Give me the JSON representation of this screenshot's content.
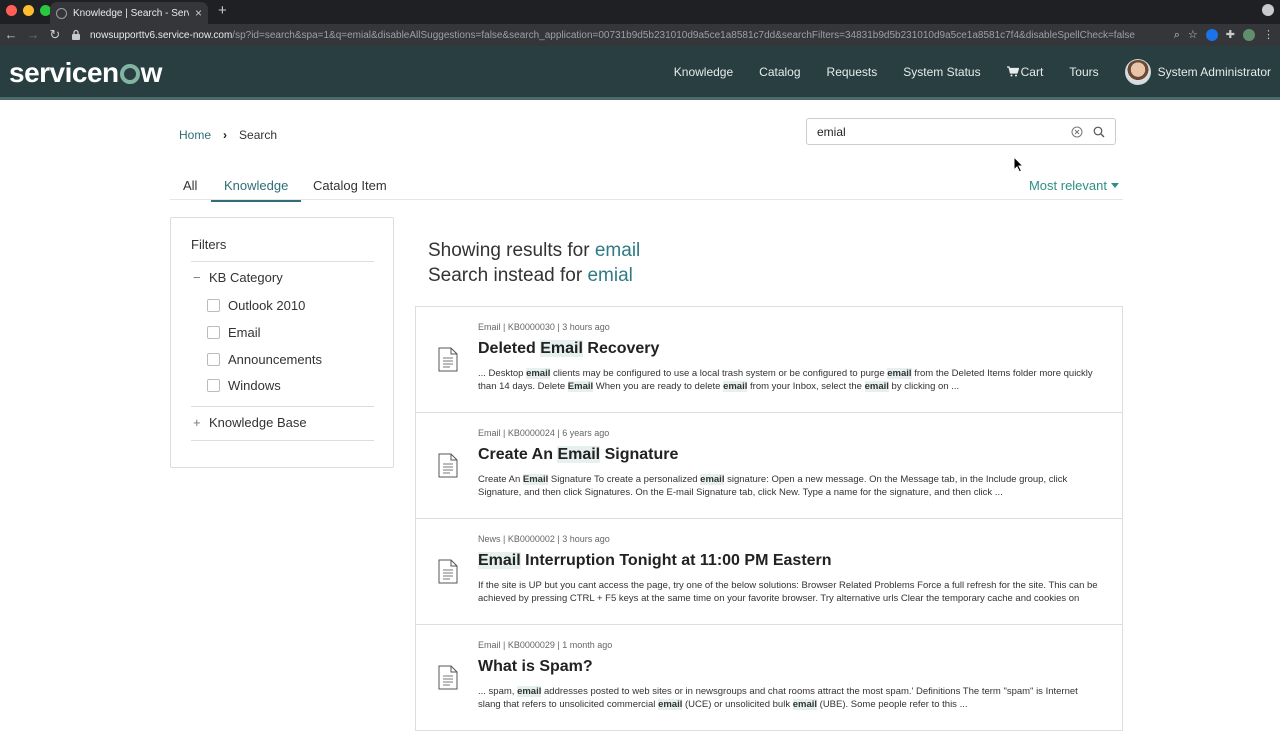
{
  "browser": {
    "tab_title": "Knowledge | Search - Service Now",
    "url_host": "nowsupporttv6.service-now.com",
    "url_path": "/sp?id=search&spa=1&q=emial&disableAllSuggestions=false&search_application=00731b9d5b231010d9a5ce1a8581c7dd&searchFilters=34831b9d5b231010d9a5ce1a8581c7f4&disableSpellCheck=false"
  },
  "header": {
    "logo_pre": "servicen",
    "logo_post": "w",
    "nav": [
      "Knowledge",
      "Catalog",
      "Requests",
      "System Status",
      "Cart",
      "Tours"
    ],
    "user_name": "System Administrator"
  },
  "breadcrumb": {
    "home": "Home",
    "current": "Search"
  },
  "search": {
    "value": "emial"
  },
  "tabs": {
    "all": "All",
    "knowledge": "Knowledge",
    "catalog_item": "Catalog Item"
  },
  "sort": {
    "label": "Most relevant"
  },
  "filters": {
    "title": "Filters",
    "group1": "KB Category",
    "options": [
      "Outlook 2010",
      "Email",
      "Announcements",
      "Windows"
    ],
    "group2": "Knowledge Base"
  },
  "showing": {
    "line1_prefix": "Showing results for ",
    "line1_term": "email",
    "line2_prefix": "Search instead for ",
    "line2_term": "emial"
  },
  "results": [
    {
      "meta": "Email | KB0000030 | 3 hours ago",
      "title_pre": "Deleted ",
      "title_hl": "Email",
      "title_post": " Recovery",
      "snippet": "... Desktop email clients may be configured to use a local trash system or be configured to purge email from the Deleted Items folder more quickly than 14 days. Delete Email When you are ready to delete email from your Inbox, select the email by clicking on ..."
    },
    {
      "meta": "Email | KB0000024 | 6 years ago",
      "title_pre": "Create An ",
      "title_hl": "Email",
      "title_post": " Signature",
      "snippet": "Create An Email Signature To create a personalized email signature: Open a new message. On the Message tab, in the Include group, click Signature, and then click Signatures. On the E-mail Signature tab, click New. Type a name for the signature, and then click ..."
    },
    {
      "meta": "News | KB0000002 | 3 hours ago",
      "title_pre": "",
      "title_hl": "Email",
      "title_post": " Interruption Tonight at 11:00 PM Eastern",
      "snippet": " If the site is UP but you cant access the page, try one of the below solutions: Browser Related Problems Force a full refresh for the site. This can be achieved by pressing CTRL + F5 keys at the same time on your favorite browser. Try alternative urls Clear the temporary cache and cookies on your..."
    },
    {
      "meta": "Email | KB0000029 | 1 month ago",
      "title_pre": "What is Spam?",
      "title_hl": "",
      "title_post": "",
      "snippet": "... spam, email addresses posted to web sites or in newsgroups and chat rooms attract the most spam.' Definitions The term \"spam\" is Internet slang that refers to unsolicited commercial email (UCE) or unsolicited bulk email (UBE). Some people refer to this ..."
    }
  ],
  "colors": {
    "header_bg": "#293e40",
    "accent": "#2f6e78",
    "highlight": "#e6f1ef"
  }
}
